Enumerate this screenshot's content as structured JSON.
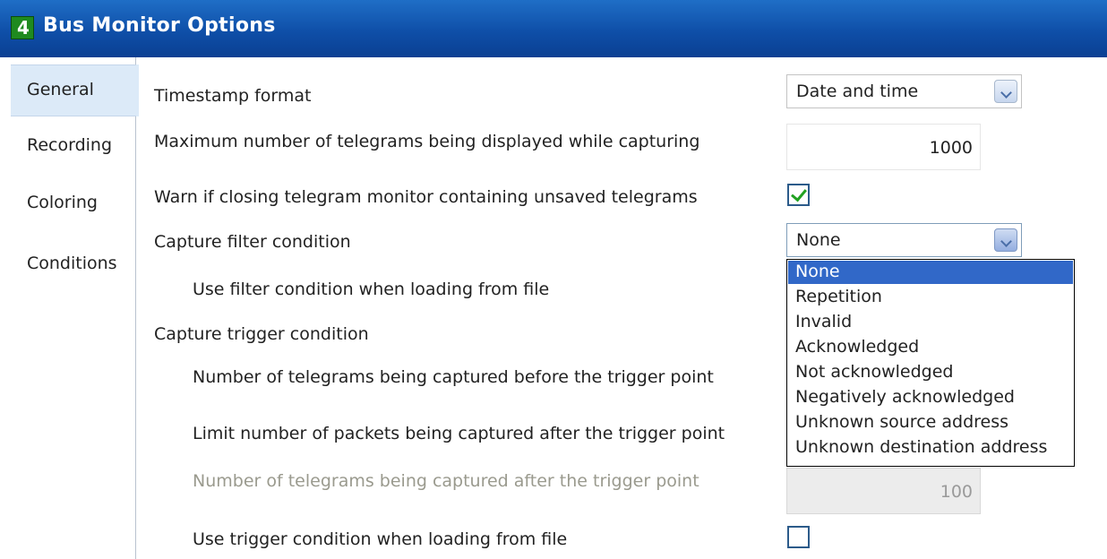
{
  "window": {
    "title": "Bus Monitor Options",
    "icon": "4"
  },
  "sidebar": {
    "items": [
      {
        "label": "General",
        "active": true
      },
      {
        "label": "Recording"
      },
      {
        "label": "Coloring"
      },
      {
        "label": "Conditions"
      }
    ]
  },
  "general": {
    "timestamp_format": {
      "label": "Timestamp format",
      "value": "Date and time"
    },
    "max_telegrams": {
      "label": "Maximum number of telegrams being displayed while capturing",
      "value": "1000"
    },
    "warn_unsaved": {
      "label": "Warn if closing telegram monitor containing unsaved telegrams",
      "checked": true
    },
    "capture_filter": {
      "label": "Capture filter condition",
      "value": "None"
    },
    "use_filter_file": {
      "label": "Use filter condition when loading from file"
    },
    "capture_trigger": {
      "label": "Capture trigger condition"
    },
    "before_trigger": {
      "label": "Number of telegrams being captured before the trigger point"
    },
    "limit_after_trigger": {
      "label": "Limit number of packets being captured after the trigger point"
    },
    "after_trigger": {
      "label": "Number of telegrams being captured after the trigger point",
      "value": "100",
      "disabled": true
    },
    "use_trigger_file": {
      "label": "Use trigger condition when loading from file",
      "checked": false
    }
  },
  "filter_dropdown": {
    "selected": "None",
    "options": [
      "None",
      "Repetition",
      "Invalid",
      "Acknowledged",
      "Not acknowledged",
      "Negatively acknowledged",
      "Unknown source address",
      "Unknown destination address"
    ]
  },
  "colors": {
    "titlebar": "#0f4fa8",
    "selection": "#3168c8",
    "sidebar_active": "#dceaf8",
    "check": "#21a121"
  }
}
